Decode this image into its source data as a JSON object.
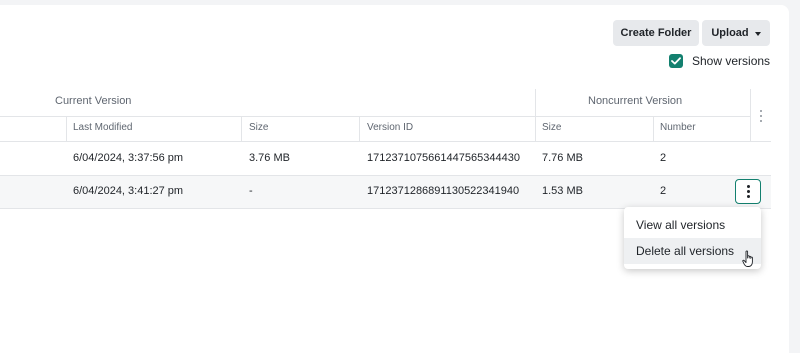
{
  "toolbar": {
    "create_folder_label": "Create Folder",
    "upload_label": "Upload",
    "show_versions_label": "Show versions",
    "show_versions_checked": true
  },
  "table": {
    "group_current": "Current Version",
    "group_noncurrent": "Noncurrent Version",
    "columns": {
      "last_modified": "Last Modified",
      "size": "Size",
      "version_id": "Version ID",
      "nc_size": "Size",
      "number": "Number"
    },
    "rows": [
      {
        "last_modified": "6/04/2024, 3:37:56 pm",
        "size": "3.76 MB",
        "version_id": "1712371075661447565344430",
        "nc_size": "7.76 MB",
        "number": "2"
      },
      {
        "last_modified": "6/04/2024, 3:41:27 pm",
        "size": "-",
        "version_id": "1712371286891130522341940",
        "nc_size": "1.53 MB",
        "number": "2"
      }
    ]
  },
  "menu": {
    "items": [
      "View all versions",
      "Delete all versions"
    ]
  },
  "colors": {
    "accent": "#13806f",
    "button_bg": "#e7e9ec"
  }
}
